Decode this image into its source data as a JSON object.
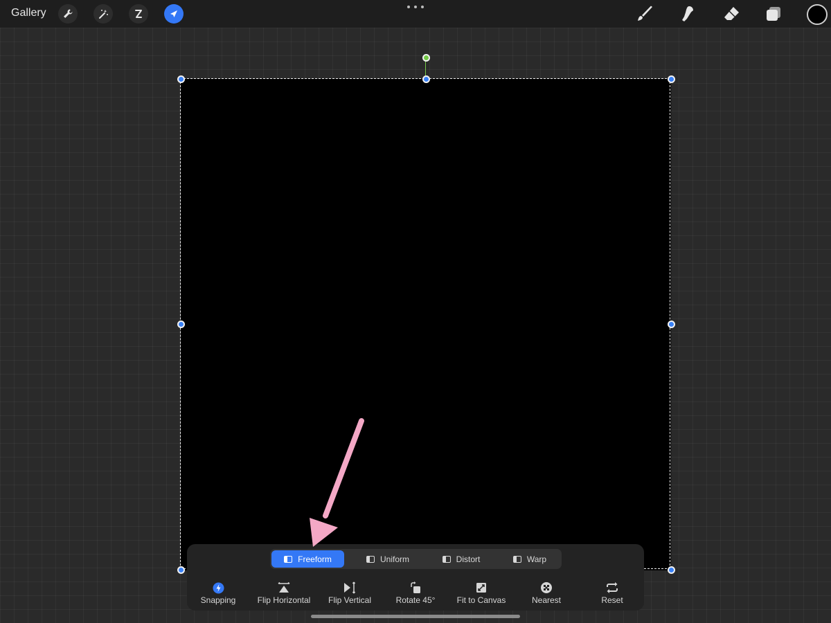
{
  "topbar": {
    "gallery_label": "Gallery",
    "tools_left": [
      {
        "icon": "wrench-icon"
      },
      {
        "icon": "magic-wand-icon"
      },
      {
        "icon": "selection-icon"
      },
      {
        "icon": "transform-arrow-icon",
        "active": true
      }
    ],
    "tools_right": [
      {
        "icon": "brush-icon"
      },
      {
        "icon": "smudge-icon"
      },
      {
        "icon": "eraser-icon"
      },
      {
        "icon": "layers-icon"
      }
    ],
    "current_color": "#000000"
  },
  "transform_modes": {
    "selected": "Freeform",
    "items": [
      {
        "label": "Freeform"
      },
      {
        "label": "Uniform"
      },
      {
        "label": "Distort"
      },
      {
        "label": "Warp"
      }
    ]
  },
  "actions": [
    {
      "label": "Snapping",
      "icon": "snapping-bolt-icon"
    },
    {
      "label": "Flip Horizontal",
      "icon": "flip-horizontal-icon"
    },
    {
      "label": "Flip Vertical",
      "icon": "flip-vertical-icon"
    },
    {
      "label": "Rotate 45°",
      "icon": "rotate-icon"
    },
    {
      "label": "Fit to Canvas",
      "icon": "fit-canvas-icon"
    },
    {
      "label": "Nearest",
      "icon": "nearest-icon"
    },
    {
      "label": "Reset",
      "icon": "reset-icon"
    }
  ],
  "colors": {
    "accent": "#3478f6",
    "annotation_arrow": "#f4a8c6",
    "rotation_handle": "#74c947"
  }
}
